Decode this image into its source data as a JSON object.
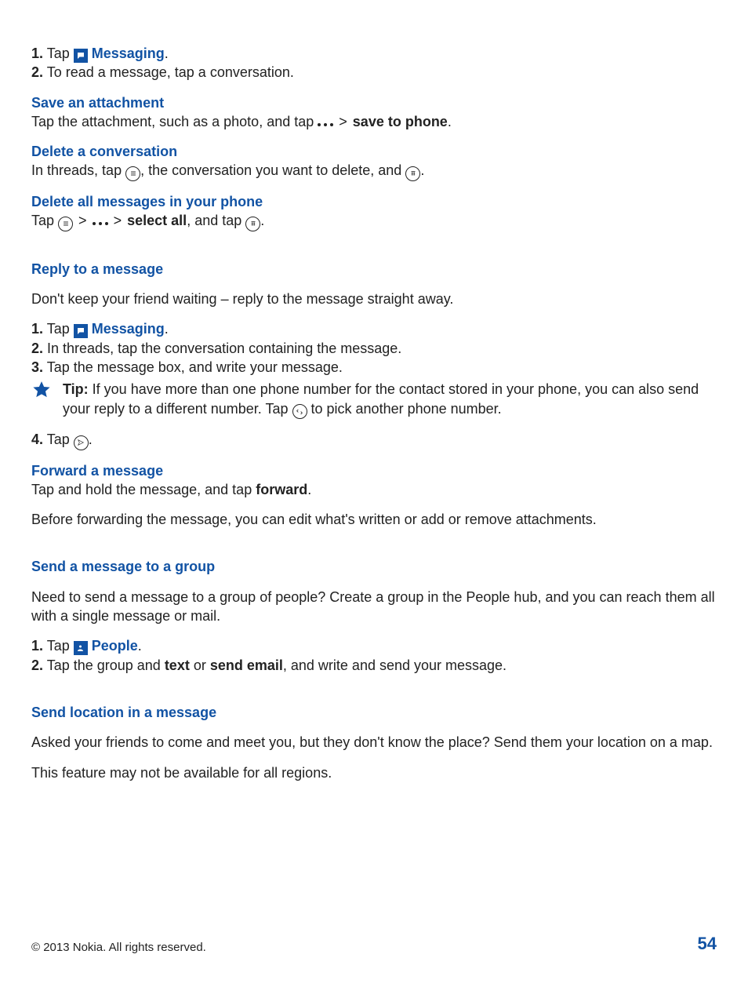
{
  "intro": {
    "step1_num": "1.",
    "step1_tap": " Tap ",
    "step1_app": " Messaging",
    "step1_end": ".",
    "step2_num": "2.",
    "step2_text": " To read a message, tap a conversation."
  },
  "save_attach": {
    "heading": "Save an attachment",
    "line1a": "Tap the attachment, such as a photo, and tap ",
    "save_to_phone": "save to phone",
    "end": "."
  },
  "delete_conv": {
    "heading": "Delete a conversation",
    "line_a": "In threads, tap ",
    "line_b": ", the conversation you want to delete, and ",
    "end": "."
  },
  "delete_all": {
    "heading": "Delete all messages in your phone",
    "line_a": "Tap ",
    "select_all": "select all",
    "line_b": ", and tap ",
    "end": "."
  },
  "reply": {
    "heading": "Reply to a message",
    "intro": "Don't keep your friend waiting – reply to the message straight away.",
    "s1_num": "1.",
    "s1_tap": " Tap ",
    "s1_app": " Messaging",
    "s1_end": ".",
    "s2_num": "2.",
    "s2": " In threads, tap the conversation containing the message.",
    "s3_num": "3.",
    "s3": " Tap the message box, and write your message.",
    "tip_label": "Tip:",
    "tip_a": " If you have more than one phone number for the contact stored in your phone, you can also send your reply to a different number. Tap ",
    "tip_b": " to pick another phone number.",
    "s4_num": "4.",
    "s4": " Tap ",
    "s4_end": "."
  },
  "forward": {
    "heading": "Forward a message",
    "line_a": "Tap and hold the message, and tap ",
    "forward": "forward",
    "end": ".",
    "note": "Before forwarding the message, you can edit what's written or add or remove attachments."
  },
  "group": {
    "heading": "Send a message to a group",
    "intro": "Need to send a message to a group of people? Create a group in the People hub, and you can reach them all with a single message or mail.",
    "s1_num": "1.",
    "s1_tap": " Tap ",
    "s1_app": " People",
    "s1_end": ".",
    "s2_num": "2.",
    "s2a": " Tap the group and ",
    "s2_text": "text",
    "s2_or": " or ",
    "s2_email": "send email",
    "s2b": ", and write and send your message."
  },
  "location": {
    "heading": "Send location in a message",
    "intro": "Asked your friends to come and meet you, but they don't know the place? Send them your location on a map.",
    "note": "This feature may not be available for all regions."
  },
  "footer": {
    "copyright": "© 2013 Nokia. All rights reserved.",
    "page": "54"
  },
  "gt": ">"
}
